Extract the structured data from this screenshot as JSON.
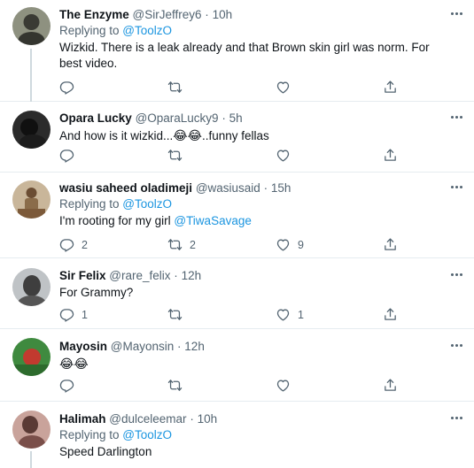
{
  "tweets": [
    {
      "name": "The Enzyme",
      "handle": "@SirJeffrey6",
      "dot": "·",
      "time": "10h",
      "replying_prefix": "Replying to ",
      "replying_to": "@ToolzO",
      "text": "Wizkid. There is a leak already and that Brown skin girl was norm. For best video.",
      "reply_count": "",
      "retweet_count": "",
      "like_count": "",
      "avatar_colors": [
        "#8e9180",
        "#34352f"
      ]
    },
    {
      "name": "Opara Lucky",
      "handle": "@OparaLucky9",
      "dot": "·",
      "time": "5h",
      "text_prefix": "And how is it wizkid...",
      "text_emoji": "😂😂",
      "text_suffix": "..funny fellas",
      "reply_count": "",
      "retweet_count": "",
      "like_count": "",
      "avatar_colors": [
        "#2b2b2b",
        "#101010"
      ]
    },
    {
      "name": "wasiu saheed oladimeji",
      "handle": "@wasiusaid",
      "dot": "·",
      "time": "15h",
      "replying_prefix": "Replying to ",
      "replying_to": "@ToolzO",
      "text_prefix": "I'm rooting for my girl ",
      "text_mention": "@TiwaSavage",
      "reply_count": "2",
      "retweet_count": "2",
      "like_count": "9",
      "avatar_colors": [
        "#c9b69a",
        "#6b4d33"
      ]
    },
    {
      "name": "Sir Felix",
      "handle": "@rare_felix",
      "dot": "·",
      "time": "12h",
      "text": "For Grammy?",
      "reply_count": "1",
      "retweet_count": "",
      "like_count": "1",
      "avatar_colors": [
        "#bfc3c6",
        "#4a4a4a"
      ]
    },
    {
      "name": "Mayosin",
      "handle": "@Mayonsin",
      "dot": "·",
      "time": "12h",
      "text_emoji": "😂😂",
      "reply_count": "",
      "retweet_count": "",
      "like_count": "",
      "avatar_colors": [
        "#3f8a3f",
        "#c23a2f"
      ]
    },
    {
      "name": "Halimah",
      "handle": "@dulceleemar",
      "dot": "·",
      "time": "10h",
      "replying_prefix": "Replying to ",
      "replying_to": "@ToolzO",
      "text": "Speed Darlington",
      "avatar_colors": [
        "#c9a39b",
        "#7a4f4a"
      ]
    }
  ],
  "colors": {
    "accent": "#1b95e0",
    "muted": "#536471",
    "divider": "#e6ecf0"
  },
  "icons": [
    "reply-icon",
    "retweet-icon",
    "like-icon",
    "share-icon",
    "more-icon"
  ]
}
